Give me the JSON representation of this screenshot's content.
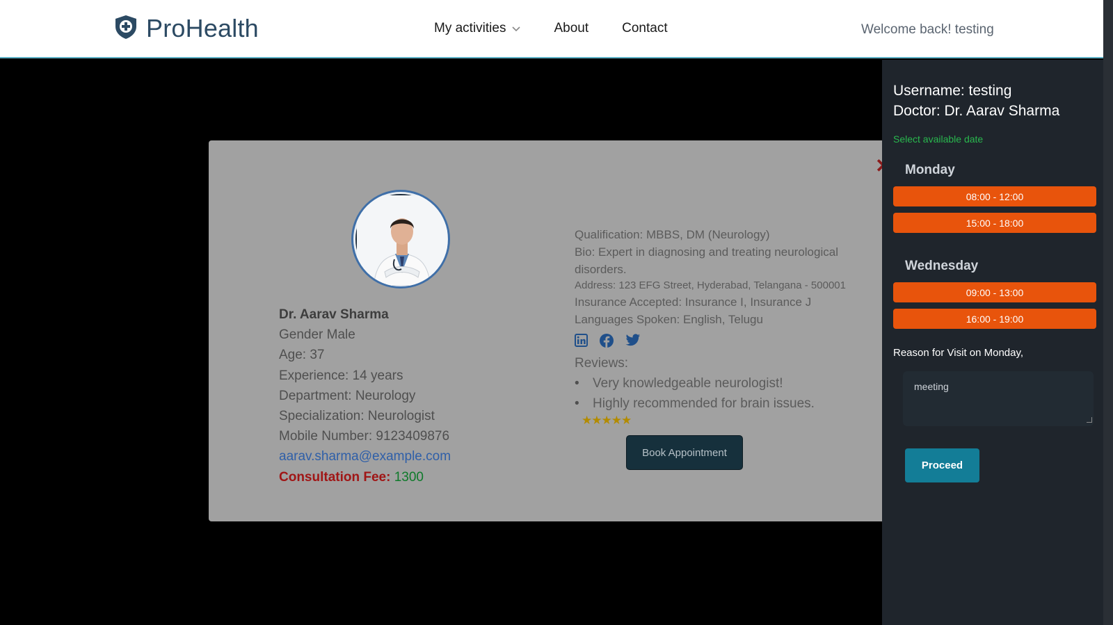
{
  "brand": {
    "name": "ProHealth",
    "icon": "shield-plus-icon",
    "color": "#2c4a63"
  },
  "nav": {
    "activities": "My activities",
    "about": "About",
    "contact": "Contact",
    "welcome": "Welcome back! testing"
  },
  "doctor": {
    "name": "Dr. Aarav Sharma",
    "gender": "Gender Male",
    "age": "Age: 37",
    "experience": "Experience: 14 years",
    "department": "Department: Neurology",
    "specialization": "Specialization: Neurologist",
    "mobile": "Mobile Number: 9123409876",
    "email": "aarav.sharma@example.com",
    "fee_label": "Consultation Fee:",
    "fee_value": "1300",
    "qualification": "Qualification: MBBS, DM (Neurology)",
    "bio": "Bio: Expert in diagnosing and treating neurological disorders.",
    "address": "Address: 123 EFG Street, Hyderabad, Telangana - 500001",
    "insurance": "Insurance Accepted: Insurance I, Insurance J",
    "languages": "Languages Spoken: English, Telugu",
    "reviews_label": "Reviews:",
    "reviews": [
      "Very knowledgeable neurologist!",
      "Highly recommended for brain issues."
    ],
    "rating_stars": "★★★★★",
    "rating": 5,
    "book_button": "Book Appointment",
    "close": "✕"
  },
  "sidebar": {
    "username": "Username: testing",
    "doctor": "Doctor: Dr. Aarav Sharma",
    "select_hint": "Select available date",
    "days": [
      {
        "day": "Monday",
        "slots": [
          "08:00 - 12:00",
          "15:00 - 18:00"
        ]
      },
      {
        "day": "Wednesday",
        "slots": [
          "09:00 - 13:00",
          "16:00 - 19:00"
        ]
      }
    ],
    "reason_label": "Reason for Visit on Monday,",
    "reason_value": "meeting",
    "proceed": "Proceed",
    "slot_color": "#e8540c",
    "proceed_color": "#137d97"
  }
}
